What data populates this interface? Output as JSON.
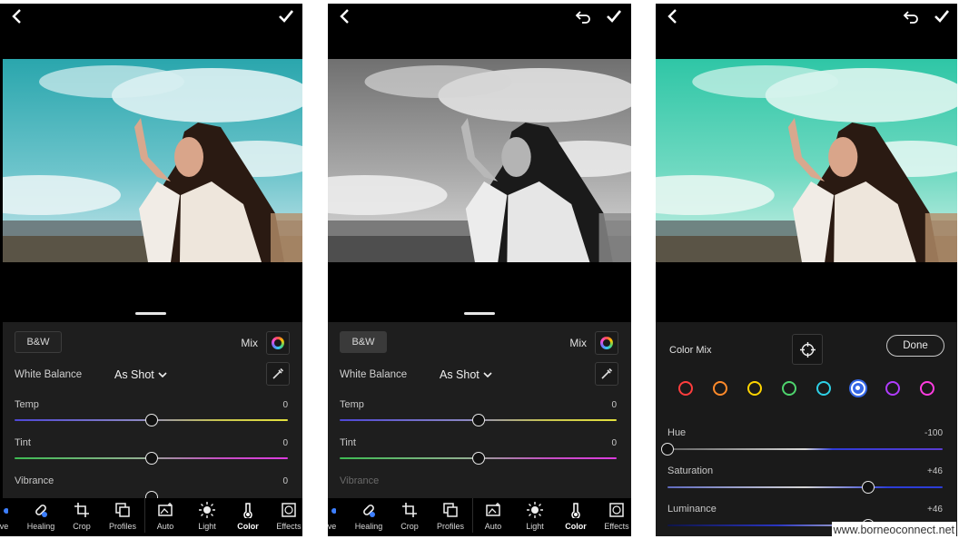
{
  "watermark": "www.borneoconnect.net",
  "panels": {
    "left": {
      "bw_label": "B&W",
      "mix_label": "Mix",
      "white_balance": {
        "label": "White Balance",
        "value": "As Shot"
      },
      "sliders": [
        {
          "label": "Temp",
          "value": "0"
        },
        {
          "label": "Tint",
          "value": "0"
        },
        {
          "label": "Vibrance",
          "value": "0"
        }
      ],
      "tools": [
        "ctive",
        "Healing",
        "Crop",
        "Profiles",
        "Auto",
        "Light",
        "Color",
        "Effects"
      ]
    },
    "middle": {
      "bw_label": "B&W",
      "mix_label": "Mix",
      "white_balance": {
        "label": "White Balance",
        "value": "As Shot"
      },
      "sliders": [
        {
          "label": "Temp",
          "value": "0"
        },
        {
          "label": "Tint",
          "value": "0"
        },
        {
          "label": "Vibrance",
          "value": ""
        }
      ],
      "tools": [
        "ctive",
        "Healing",
        "Crop",
        "Profiles",
        "Auto",
        "Light",
        "Color",
        "Effects"
      ]
    },
    "right": {
      "color_mix_label": "Color Mix",
      "done_label": "Done",
      "color_dots": [
        {
          "name": "red",
          "color": "#ff3d3d"
        },
        {
          "name": "orange",
          "color": "#ff8a2a"
        },
        {
          "name": "yellow",
          "color": "#ffd400"
        },
        {
          "name": "green",
          "color": "#4ed46d"
        },
        {
          "name": "aqua",
          "color": "#2ed0e6"
        },
        {
          "name": "blue",
          "color": "#3567e6",
          "selected": true
        },
        {
          "name": "purple",
          "color": "#b03cff"
        },
        {
          "name": "magenta",
          "color": "#ff3ce0"
        }
      ],
      "sliders": [
        {
          "label": "Hue",
          "value": "-100",
          "level": -1.0
        },
        {
          "label": "Saturation",
          "value": "+46",
          "level": 0.46
        },
        {
          "label": "Luminance",
          "value": "+46",
          "level": 0.46
        }
      ]
    }
  },
  "slider_levels": {
    "temp": 0,
    "tint": 0
  },
  "colors": {
    "teal_sky": "#3fb3b8",
    "mint_sky": "#4ed2b2",
    "background": "#000000",
    "sheet": "#1e1e1e"
  }
}
